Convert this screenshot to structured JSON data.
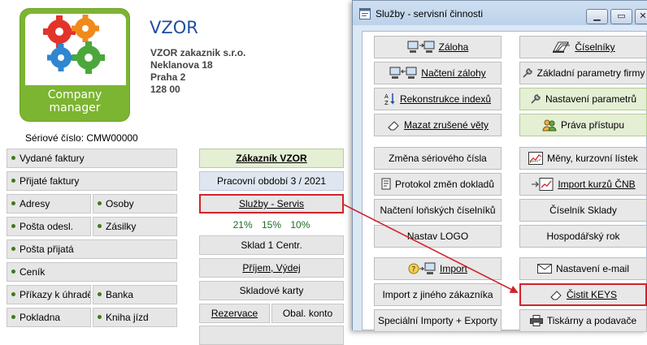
{
  "app": {
    "title": "VZOR",
    "logo_line1": "Company",
    "logo_line2": "manager",
    "company_name": "VZOR zakaznik s.r.o.",
    "street": "Neklanova 18",
    "city": "Praha 2",
    "zip": "128 00",
    "serial": "Sériové číslo: CMW00000"
  },
  "left_menu": {
    "vydane_faktury": "Vydané faktury",
    "prijate_faktury": "Přijaté faktury",
    "adresy": "Adresy",
    "osoby": "Osoby",
    "posta_odesl": "Pošta odesl.",
    "zasilky": "Zásilky",
    "posta_prijata": "Pošta přijatá",
    "cenik": "Ceník",
    "prikazy": "Příkazy k úhradě",
    "banka": "Banka",
    "pokladna": "Pokladna",
    "kniha_jizd": "Kniha jízd"
  },
  "center_menu": {
    "zakaznik": "Zákazník  VZOR",
    "obdobi": "Pracovní období  3 / 2021",
    "sluzby": "Služby - Servis",
    "percent_1": "21%",
    "percent_2": "15%",
    "percent_3": "10%",
    "sklad": "Sklad 1 Centr.",
    "prijem": "Příjem, Výdej",
    "skladove_karty": "Skladové karty",
    "rezervace": "Rezervace",
    "obal_konto": "Obal. konto"
  },
  "dialog": {
    "title": "Služby - servisní činnosti",
    "left_buttons": {
      "zaloha": "Záloha",
      "nacteni_zalohy": "Načtení zálohy",
      "rekonstrukce": "Rekonstrukce indexů",
      "mazat": "Mazat zrušené věty",
      "zmena_serioveho": "Změna sériového čísla",
      "protokol": "Protokol změn dokladů",
      "nacteni_lonskych": "Načtení loňských číselníků",
      "nastav_logo": "Nastav LOGO",
      "import": "Import",
      "import_jineho": "Import z jiného zákazníka",
      "specialni_importy": "Speciální Importy + Exporty"
    },
    "right_buttons": {
      "ciselniky": "Číselníky",
      "zakladni_parametry": "Základní parametry firmy",
      "nastaveni_parametru": "Nastavení parametrů",
      "prava_pristupu": "Práva přístupu",
      "meny": "Měny, kurzovní lístek",
      "import_kurzu": "Import kurzů ČNB",
      "ciselnik_sklady": "Číselník Sklady",
      "hospodarsky_rok": "Hospodářský rok",
      "nastaveni_email": "Nastavení e-mail",
      "cistit_keys": "Čistit KEYS",
      "tiskarny": "Tiskárny a podavače"
    }
  },
  "colors": {
    "title_blue": "#1f4e9e",
    "highlight_red": "#d0232a",
    "logo_green": "#7cb531",
    "percent_green": "#1d6b23"
  }
}
